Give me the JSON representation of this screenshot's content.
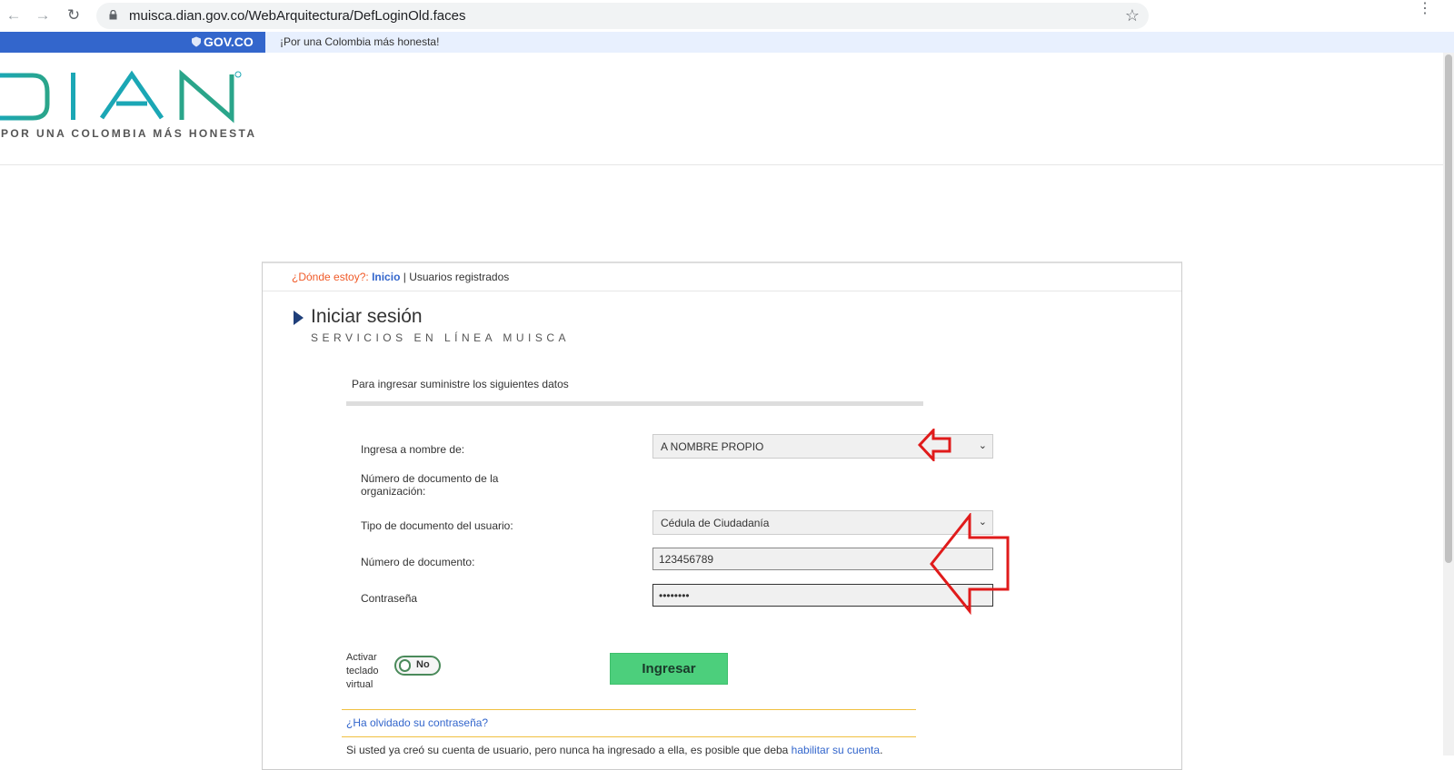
{
  "browser": {
    "url": "muisca.dian.gov.co/WebArquitectura/DefLoginOld.faces",
    "back_glyph": "←",
    "forward_glyph": "→",
    "reload_glyph": "↻",
    "star_glyph": "☆",
    "menu_glyph": "⋮"
  },
  "gov_bar": {
    "brand": "GOV.CO",
    "slogan": "¡Por una Colombia más honesta!"
  },
  "header": {
    "logo_text": "DIAN",
    "tagline": "POR UNA COLOMBIA MÁS HONESTA"
  },
  "breadcrumb": {
    "prefix": "¿Dónde estoy?:",
    "home": "Inicio",
    "separator": "|",
    "current": "Usuarios registrados"
  },
  "page": {
    "title": "Iniciar sesión",
    "subtitle": "SERVICIOS EN LÍNEA MUISCA"
  },
  "form": {
    "header": "Para ingresar suministre los siguientes datos",
    "on_behalf_label": "Ingresa a nombre de:",
    "on_behalf_value": "A NOMBRE PROPIO",
    "org_doc_label_1": "Número de documento de la",
    "org_doc_label_2": "organización:",
    "doc_type_label": "Tipo de documento del usuario:",
    "doc_type_value": "Cédula de Ciudadanía",
    "doc_number_label": "Número de documento:",
    "doc_number_value": "123456789",
    "password_label": "Contraseña",
    "password_value": "••••••••",
    "virtual_kbd_label_1": "Activar",
    "virtual_kbd_label_2": "teclado",
    "virtual_kbd_label_3": "virtual",
    "virtual_kbd_toggle": "No",
    "submit_label": "Ingresar",
    "chevron_glyph": "⌄"
  },
  "footer": {
    "forgot_link": "¿Ha olvidado su contraseña?",
    "note_text": "Si usted ya creó su cuenta de usuario, pero nunca ha ingresado a ella, es posible que deba ",
    "note_link": "habilitar su cuenta",
    "note_end": "."
  },
  "colors": {
    "gov_blue": "#3366cc",
    "dian_teal": "#1ba7b5",
    "button_green": "#4ccf7c",
    "annotation_red": "#e01b1b"
  },
  "icons": {
    "lock": "lock-icon",
    "star": "bookmark-star-icon",
    "title_arrow": "play-arrow-icon",
    "annotation": "red-arrow-icon"
  }
}
